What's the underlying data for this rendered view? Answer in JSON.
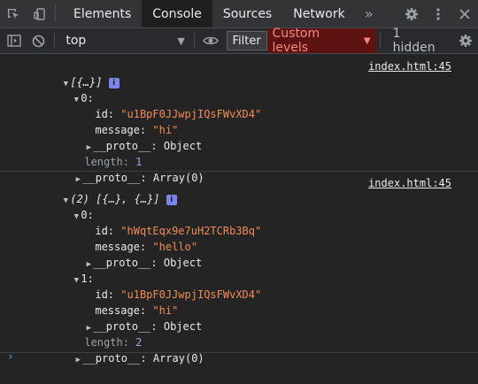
{
  "tabs": [
    "Elements",
    "Console",
    "Sources",
    "Network"
  ],
  "active_tab": "Console",
  "tab_overflow": "»",
  "toolbar": {
    "context": "top",
    "filter_label": "Filter",
    "levels_label": "Custom levels",
    "hidden_count": "1 hidden"
  },
  "log1": {
    "summary": "[{…}]",
    "info_badge": "i",
    "source": "index.html:45",
    "item_index": "0:",
    "id_key": "id:",
    "id_value": "\"u1BpF0JJwpjIQsFWvXD4\"",
    "message_key": "message:",
    "message_value": "\"hi\"",
    "proto_obj": "__proto__",
    "object_label": "Object",
    "length_key": "length:",
    "length_value": "1",
    "proto_arr": "__proto__",
    "array_label": "Array(0)"
  },
  "log2": {
    "count": "(2)",
    "summary": "[{…}, {…}]",
    "info_badge": "i",
    "source": "index.html:45",
    "item0_index": "0:",
    "item0_id_key": "id:",
    "item0_id_value": "\"hWqtEqx9e7uH2TCRb3Bq\"",
    "item0_message_key": "message:",
    "item0_message_value": "\"hello\"",
    "item0_proto": "__proto__",
    "item0_object_label": "Object",
    "item1_index": "1:",
    "item1_id_key": "id:",
    "item1_id_value": "\"u1BpF0JJwpjIQsFWvXD4\"",
    "item1_message_key": "message:",
    "item1_message_value": "\"hi\"",
    "item1_proto": "__proto__",
    "item1_object_label": "Object",
    "length_key": "length:",
    "length_value": "2",
    "proto_arr": "__proto__",
    "array_label": "Array(0)"
  },
  "prompt_symbol": "›",
  "colors": {
    "string": "#f28b54",
    "number": "#9e9cf7",
    "levels_bg": "#5e1212",
    "levels_fg": "#f28b82",
    "prompt": "#4f9bf0"
  },
  "icons": [
    "inspect-element-icon",
    "device-toolbar-icon",
    "settings-gear-icon",
    "more-vert-icon",
    "close-icon",
    "sidebar-toggle-icon",
    "clear-console-icon",
    "eye-icon",
    "console-settings-gear-icon"
  ]
}
